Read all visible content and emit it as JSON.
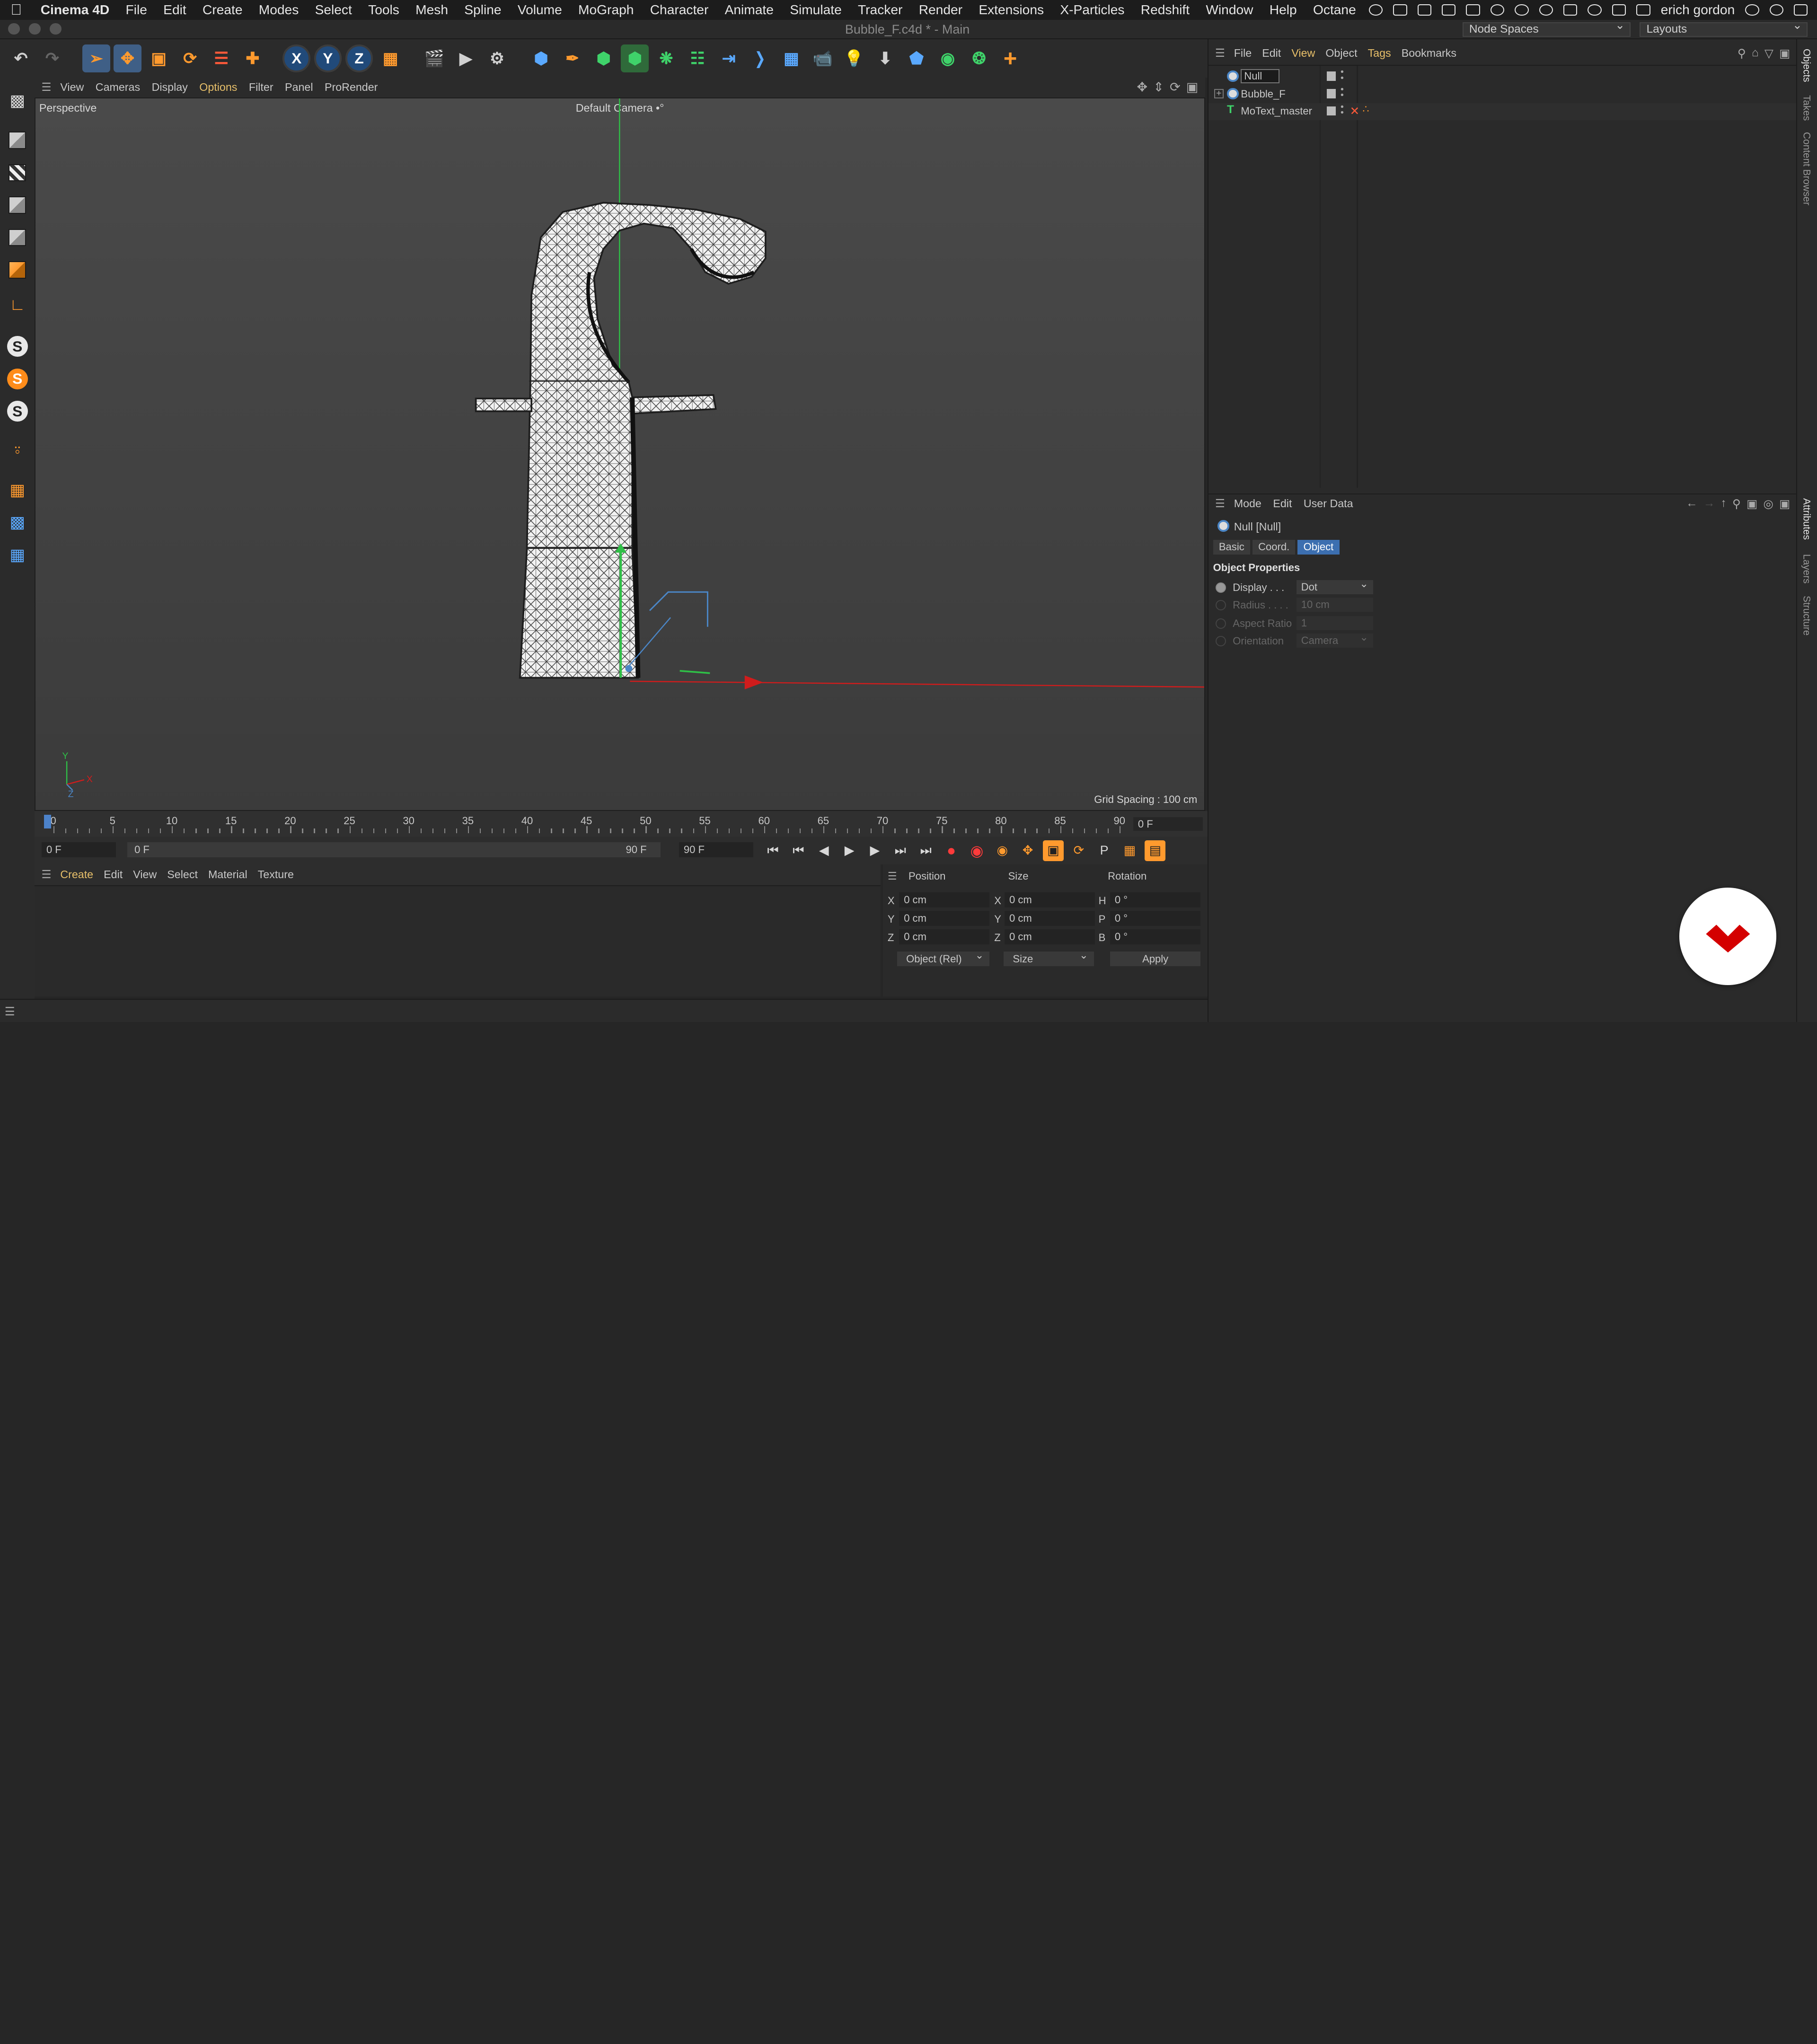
{
  "menubar": {
    "app": "Cinema 4D",
    "items": [
      "File",
      "Edit",
      "Create",
      "Modes",
      "Select",
      "Tools",
      "Mesh",
      "Spline",
      "Volume",
      "MoGraph",
      "Character",
      "Animate",
      "Simulate",
      "Tracker",
      "Render",
      "Extensions",
      "X-Particles",
      "Redshift",
      "Window",
      "Help",
      "Octane"
    ],
    "user": "erich gordon"
  },
  "window": {
    "title": "Bubble_F.c4d * - Main",
    "node_spaces": "Node Spaces",
    "layouts": "Layouts"
  },
  "viewport": {
    "menu": [
      "View",
      "Cameras",
      "Display",
      "Options",
      "Filter",
      "Panel",
      "ProRender"
    ],
    "label": "Perspective",
    "camera": "Default Camera •°",
    "grid_spacing": "Grid Spacing : 100 cm",
    "axis_y": "Y",
    "axis_x": "X",
    "axis_z": "Z"
  },
  "timeline": {
    "ticks": [
      "0",
      "5",
      "10",
      "15",
      "20",
      "25",
      "30",
      "35",
      "40",
      "45",
      "50",
      "55",
      "60",
      "65",
      "70",
      "75",
      "80",
      "85",
      "90"
    ],
    "current_frame": "0 F",
    "start_frame": "0 F",
    "range_start": "0 F",
    "range_end": "90 F",
    "end_frame": "90 F"
  },
  "material": {
    "menu": [
      "Create",
      "Edit",
      "View",
      "Select",
      "Material",
      "Texture"
    ]
  },
  "coordinates": {
    "headers": {
      "position": "Position",
      "size": "Size",
      "rotation": "Rotation"
    },
    "rows": [
      {
        "axis": "X",
        "pos": "0 cm",
        "size_axis": "X",
        "size": "0 cm",
        "rot_axis": "H",
        "rot": "0 °"
      },
      {
        "axis": "Y",
        "pos": "0 cm",
        "size_axis": "Y",
        "size": "0 cm",
        "rot_axis": "P",
        "rot": "0 °"
      },
      {
        "axis": "Z",
        "pos": "0 cm",
        "size_axis": "Z",
        "size": "0 cm",
        "rot_axis": "B",
        "rot": "0 °"
      }
    ],
    "mode": "Object (Rel)",
    "size_mode": "Size",
    "apply": "Apply"
  },
  "objects": {
    "menu": [
      "File",
      "Edit",
      "View",
      "Object",
      "Tags",
      "Bookmarks"
    ],
    "items": [
      {
        "name": "Null",
        "type": "null"
      },
      {
        "name": "Bubble_F",
        "type": "null"
      },
      {
        "name": "MoText_master",
        "type": "motext"
      }
    ]
  },
  "attributes": {
    "menu": [
      "Mode",
      "Edit",
      "User Data"
    ],
    "title": "Null [Null]",
    "tabs": [
      "Basic",
      "Coord.",
      "Object"
    ],
    "active_tab": "Object",
    "section": "Object Properties",
    "props": [
      {
        "label": "Display . . .",
        "value": "Dot"
      },
      {
        "label": "Radius . . . .",
        "value": "10 cm"
      },
      {
        "label": "Aspect Ratio",
        "value": "1"
      },
      {
        "label": "Orientation",
        "value": "Camera"
      }
    ]
  },
  "side_tabs": [
    "Objects",
    "Takes",
    "Content Browser",
    "Attributes",
    "Layers",
    "Structure"
  ],
  "colors": {
    "accent": "#4c82c9",
    "highlight": "#e8c06a",
    "logo": "#d40000"
  }
}
